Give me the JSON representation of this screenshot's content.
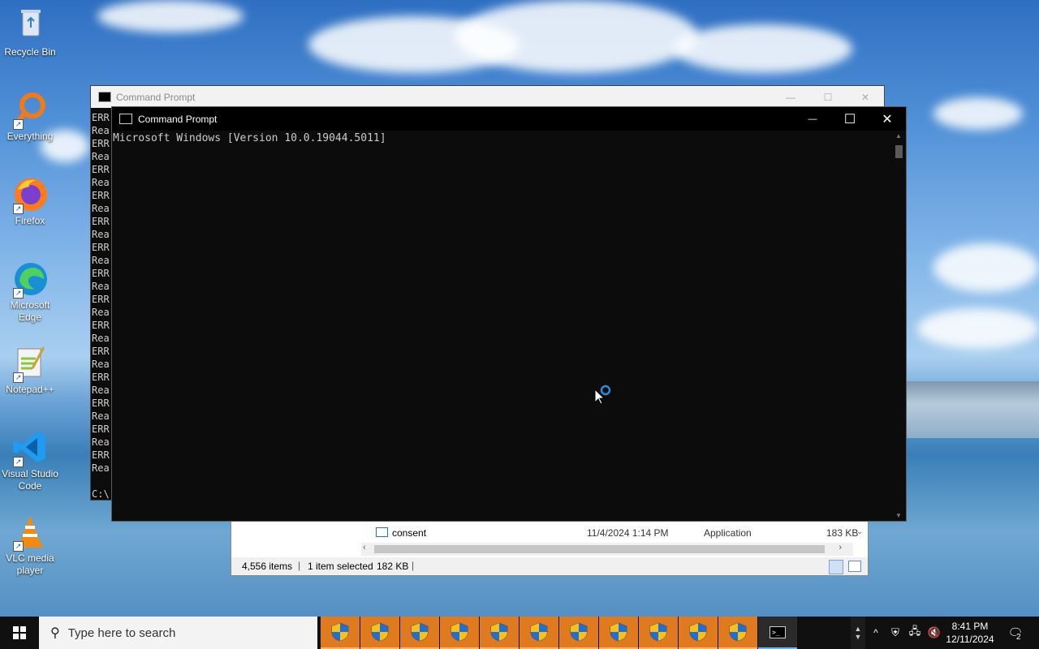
{
  "desktop": {
    "icons": [
      {
        "label": "Recycle Bin",
        "icon": "recycle-bin-icon"
      },
      {
        "label": "Everything",
        "icon": "everything-search-icon"
      },
      {
        "label": "Firefox",
        "icon": "firefox-icon"
      },
      {
        "label": "Microsoft Edge",
        "icon": "edge-icon"
      },
      {
        "label": "Notepad++",
        "icon": "notepadpp-icon"
      },
      {
        "label": "Visual Studio Code",
        "icon": "vscode-icon"
      },
      {
        "label": "VLC media player",
        "icon": "vlc-icon"
      }
    ]
  },
  "cmd_back": {
    "title": "Command Prompt",
    "lines": [
      "ERR",
      "Rea",
      "ERR",
      "Rea",
      "ERR",
      "Rea",
      "ERR",
      "Rea",
      "ERR",
      "Rea",
      "ERR",
      "Rea",
      "ERR",
      "Rea",
      "ERR",
      "Rea",
      "ERR",
      "Rea",
      "ERR",
      "Rea",
      "ERR",
      "Rea",
      "ERR",
      "Rea",
      "ERR",
      "Rea",
      "ERR",
      "Rea",
      "",
      "C:\\"
    ]
  },
  "cmd_front": {
    "title": "Command Prompt",
    "minimize_label": "—",
    "maximize_label": "☐",
    "close_label": "✕",
    "output": "Microsoft Windows [Version 10.0.19044.5011]"
  },
  "explorer": {
    "file": {
      "name": "consent",
      "date": "11/4/2024 1:14 PM",
      "type": "Application",
      "size": "183 KB"
    },
    "status": {
      "items": "4,556 items",
      "selected": "1 item selected",
      "sel_size": "182 KB"
    }
  },
  "taskbar": {
    "search_placeholder": "Type here to search",
    "time": "8:41 PM",
    "date": "12/11/2024",
    "notification_count": "2",
    "pinned_count": 11
  },
  "colors": {
    "taskbar_button": "#e07a1e",
    "accent": "#1a73e8"
  }
}
